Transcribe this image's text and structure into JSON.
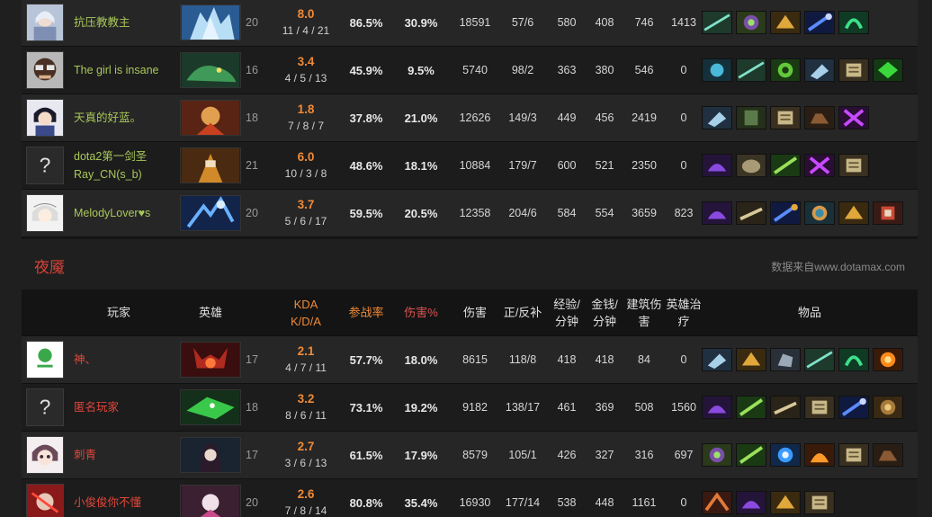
{
  "radiant": {
    "players": [
      {
        "name": "抗压教教主",
        "name2": "",
        "level": "20",
        "kda_ratio": "8.0",
        "kda": "11 / 4 / 21",
        "participation": "86.5%",
        "damage_pct": "30.9%",
        "damage": "18591",
        "lh_dn": "57/6",
        "xpm": "580",
        "gpm": "408",
        "building": "746",
        "healing": "1413",
        "avatar": "avatar-icon",
        "hero": "hero-portrait",
        "items": [
          "item-icon",
          "item-icon",
          "item-icon",
          "item-icon",
          "item-icon"
        ]
      },
      {
        "name": "The girl is insane",
        "name2": "",
        "level": "16",
        "kda_ratio": "3.4",
        "kda": "4 / 5 / 13",
        "participation": "45.9%",
        "damage_pct": "9.5%",
        "damage": "5740",
        "lh_dn": "98/2",
        "xpm": "363",
        "gpm": "380",
        "building": "546",
        "healing": "0",
        "avatar": "avatar-icon",
        "hero": "hero-portrait",
        "items": [
          "item-icon",
          "item-icon",
          "item-icon",
          "item-icon",
          "item-icon",
          "item-icon"
        ]
      },
      {
        "name": "天真的好蓝。",
        "name2": "",
        "level": "18",
        "kda_ratio": "1.8",
        "kda": "7 / 8 / 7",
        "participation": "37.8%",
        "damage_pct": "21.0%",
        "damage": "12626",
        "lh_dn": "149/3",
        "xpm": "449",
        "gpm": "456",
        "building": "2419",
        "healing": "0",
        "avatar": "avatar-icon",
        "hero": "hero-portrait",
        "items": [
          "item-icon",
          "item-icon",
          "item-icon",
          "item-icon",
          "item-icon"
        ]
      },
      {
        "name": "dota2第一剑圣",
        "name2": "Ray_CN(s_b)",
        "level": "21",
        "kda_ratio": "6.0",
        "kda": "10 / 3 / 8",
        "participation": "48.6%",
        "damage_pct": "18.1%",
        "damage": "10884",
        "lh_dn": "179/7",
        "xpm": "600",
        "gpm": "521",
        "building": "2350",
        "healing": "0",
        "avatar": "question-avatar-icon",
        "hero": "hero-portrait",
        "items": [
          "item-icon",
          "item-icon",
          "item-icon",
          "item-icon",
          "item-icon"
        ]
      },
      {
        "name": "MelodyLover♥s",
        "name2": "",
        "level": "20",
        "kda_ratio": "3.7",
        "kda": "5 / 6 / 17",
        "participation": "59.5%",
        "damage_pct": "20.5%",
        "damage": "12358",
        "lh_dn": "204/6",
        "xpm": "584",
        "gpm": "554",
        "building": "3659",
        "healing": "823",
        "avatar": "avatar-icon",
        "hero": "hero-portrait",
        "items": [
          "item-icon",
          "item-icon",
          "item-icon",
          "item-icon",
          "item-icon",
          "item-icon"
        ]
      }
    ]
  },
  "dire": {
    "title": "夜魇",
    "source": "数据来自www.dotamax.com",
    "headers": {
      "player": "玩家",
      "hero": "英雄",
      "kda_line1": "KDA",
      "kda_line2": "K/D/A",
      "participation": "参战率",
      "damage_pct": "伤害%",
      "damage": "伤害",
      "lh_dn": "正/反补",
      "xpm_line1": "经验/",
      "xpm_line2": "分钟",
      "gpm_line1": "金钱/",
      "gpm_line2": "分钟",
      "building_line1": "建筑伤",
      "building_line2": "害",
      "healing_line1": "英雄治",
      "healing_line2": "疗",
      "items": "物品"
    },
    "players": [
      {
        "name": "神、",
        "name2": "",
        "level": "17",
        "kda_ratio": "2.1",
        "kda": "4 / 7 / 11",
        "participation": "57.7%",
        "damage_pct": "18.0%",
        "damage": "8615",
        "lh_dn": "118/8",
        "xpm": "418",
        "gpm": "418",
        "building": "84",
        "healing": "0",
        "avatar": "avatar-icon",
        "hero": "hero-portrait",
        "items": [
          "item-icon",
          "item-icon",
          "item-icon",
          "item-icon",
          "item-icon",
          "item-icon"
        ]
      },
      {
        "name": "匿名玩家",
        "name2": "",
        "level": "18",
        "kda_ratio": "3.2",
        "kda": "8 / 6 / 11",
        "participation": "73.1%",
        "damage_pct": "19.2%",
        "damage": "9182",
        "lh_dn": "138/17",
        "xpm": "461",
        "gpm": "369",
        "building": "508",
        "healing": "1560",
        "avatar": "question-avatar-icon",
        "hero": "hero-portrait",
        "items": [
          "item-icon",
          "item-icon",
          "item-icon",
          "item-icon",
          "item-icon",
          "item-icon"
        ]
      },
      {
        "name": "刺青",
        "name2": "",
        "level": "17",
        "kda_ratio": "2.7",
        "kda": "3 / 6 / 13",
        "participation": "61.5%",
        "damage_pct": "17.9%",
        "damage": "8579",
        "lh_dn": "105/1",
        "xpm": "426",
        "gpm": "327",
        "building": "316",
        "healing": "697",
        "avatar": "avatar-icon",
        "hero": "hero-portrait",
        "items": [
          "item-icon",
          "item-icon",
          "item-icon",
          "item-icon",
          "item-icon",
          "item-icon"
        ]
      },
      {
        "name": "小俊俊你不懂",
        "name2": "",
        "level": "20",
        "kda_ratio": "2.6",
        "kda": "7 / 8 / 14",
        "participation": "80.8%",
        "damage_pct": "35.4%",
        "damage": "16930",
        "lh_dn": "177/14",
        "xpm": "538",
        "gpm": "448",
        "building": "1161",
        "healing": "0",
        "avatar": "avatar-icon",
        "hero": "hero-portrait",
        "items": [
          "item-icon",
          "item-icon",
          "item-icon",
          "item-icon"
        ]
      }
    ]
  }
}
